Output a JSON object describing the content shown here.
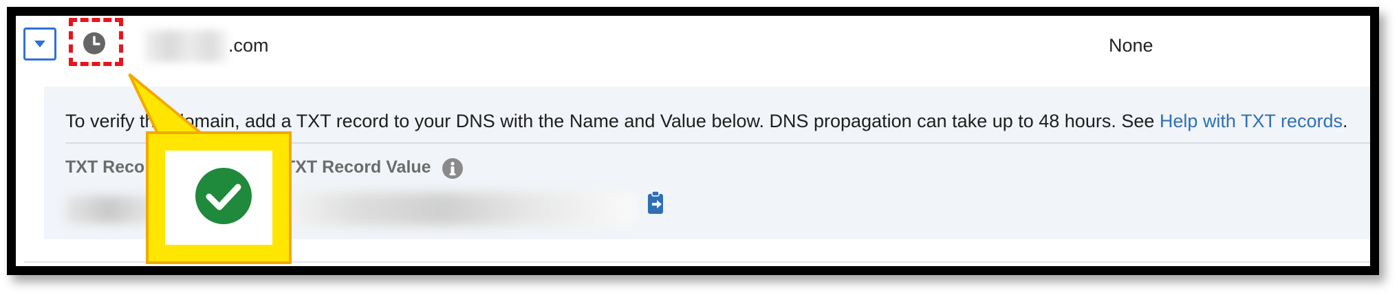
{
  "row": {
    "domain_suffix": ".com",
    "status": "None"
  },
  "details": {
    "instruction_text": "To verify this domain, add a TXT record to your DNS with the Name and Value below. DNS propagation can take up to 48 hours. See ",
    "help_link": "Help with TXT records",
    "trailing_period": ".",
    "name_label": "TXT Record Name",
    "value_label": "TXT Record Value"
  },
  "colors": {
    "accent_blue": "#2f6fd6",
    "link_blue": "#2e6fb6",
    "highlight_red": "#e8141a",
    "callout_yellow": "#ffe600",
    "success_green": "#1f8a3b"
  },
  "icons": {
    "expand": "chevron-down-icon",
    "status": "clock-icon",
    "info": "info-icon",
    "copy": "copy-clipboard-icon",
    "callout": "check-circle-icon"
  }
}
